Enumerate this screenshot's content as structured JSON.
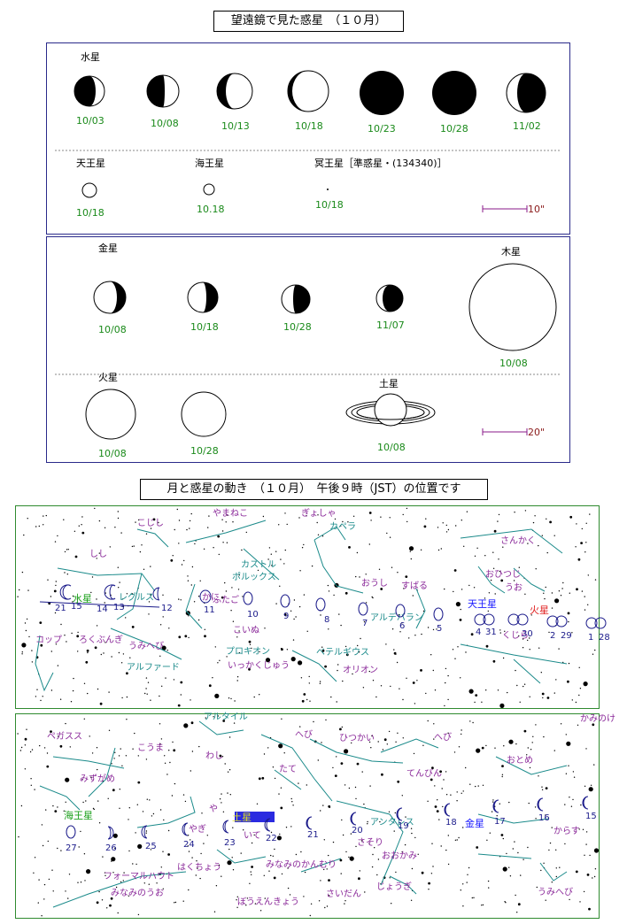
{
  "titles": {
    "top": "望遠鏡で見た惑星　（１０月）",
    "middle": "月と惑星の動き　（１０月）　午後９時（JST）の位置です"
  },
  "panel1": {
    "mercury": {
      "label": "水星",
      "dates": [
        "10/03",
        "10/08",
        "10/13",
        "10/18",
        "10/23",
        "10/28",
        "11/02"
      ]
    },
    "uranus": {
      "label": "天王星",
      "date": "10/18"
    },
    "neptune": {
      "label": "海王星",
      "date": "10.18"
    },
    "pluto": {
      "label": "冥王星［準惑星・(134340)］",
      "date": "10/18"
    },
    "scale": "10\""
  },
  "panel2": {
    "venus": {
      "label": "金星",
      "dates": [
        "10/08",
        "10/18",
        "10/28",
        "11/07"
      ]
    },
    "jupiter": {
      "label": "木星",
      "date": "10/08"
    },
    "mars": {
      "label": "火星",
      "dates": [
        "10/08",
        "10/28"
      ]
    },
    "saturn": {
      "label": "土星",
      "date": "10/08"
    },
    "scale": "20\""
  },
  "map1": {
    "constellations": [
      "こじし",
      "やまねこ",
      "ぎょしゃ",
      "カペラ",
      "さんかく",
      "しし",
      "カストル",
      "ポルックス",
      "おうし",
      "おひつじ",
      "すばる",
      "うお",
      "かに",
      "ふたご",
      "レグルス",
      "アルデバラン",
      "コップ",
      "ろくぶんぎ",
      "うみへび",
      "こいぬ",
      "アルファード",
      "プロキオン",
      "いっかくじゅう",
      "ベテルギウス",
      "オリオン",
      "くじら"
    ],
    "planets": {
      "mercury": "水星",
      "uranus": "天王星",
      "mars": "火星"
    },
    "moon_days": [
      "21",
      "15",
      "14",
      "13",
      "12",
      "11",
      "10",
      "9",
      "8",
      "7",
      "6",
      "5",
      "4",
      "31",
      "30",
      "29",
      "28",
      "2",
      "1"
    ]
  },
  "map2": {
    "constellations": [
      "かみのけ",
      "アルタイル",
      "ペガスス",
      "こうま",
      "へび",
      "ひつかい",
      "へび",
      "わし",
      "おとめ",
      "みずがめ",
      "たて",
      "てんびん",
      "や",
      "いて",
      "アンタレス",
      "さそり",
      "おおかみ",
      "からす",
      "やぎ",
      "はくちょう",
      "フォーマルハウト",
      "みなみのかんむり",
      "みなみのうお",
      "ぼうえんきょう",
      "さいだん",
      "じょうぎ",
      "うみへび"
    ],
    "planets": {
      "neptune": "海王星",
      "saturn": "土星",
      "venus": "金星"
    },
    "moon_days": [
      "27",
      "26",
      "25",
      "24",
      "23",
      "22",
      "21",
      "20",
      "19",
      "18",
      "17",
      "16",
      "15"
    ]
  }
}
